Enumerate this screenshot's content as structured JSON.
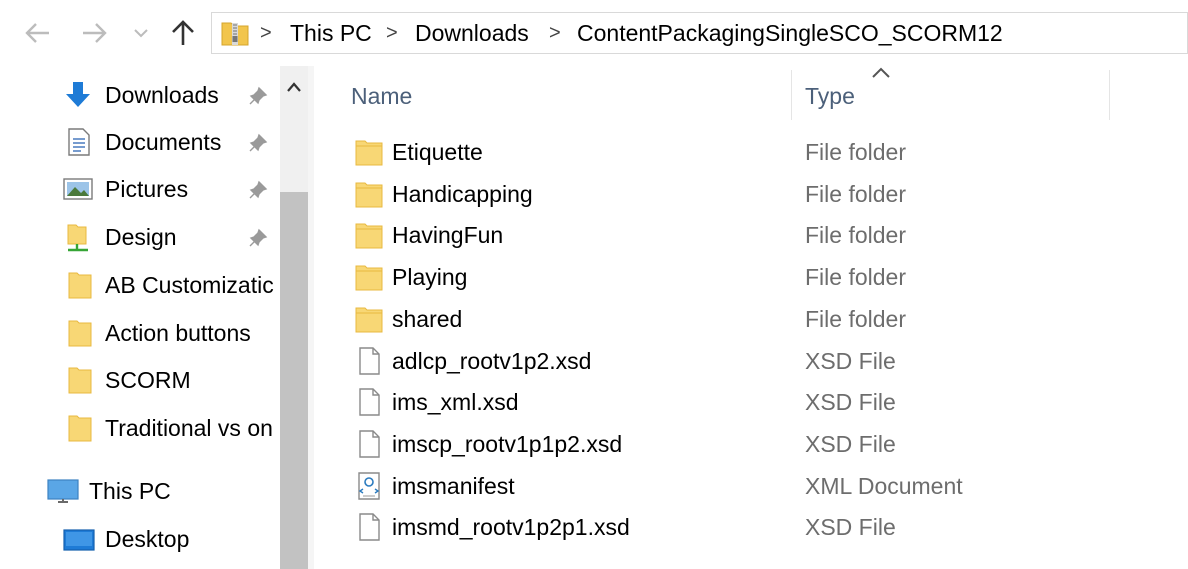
{
  "address": {
    "crumbs": [
      "This PC",
      "Downloads",
      "ContentPackagingSingleSCO_SCORM12"
    ],
    "separator": ">"
  },
  "navigation": {
    "buttons": [
      "back-arrow-icon",
      "forward-arrow-icon",
      "recent-locations-icon",
      "up-arrow-icon"
    ]
  },
  "sidebar": {
    "items": [
      {
        "label": "Downloads",
        "icon": "downloads-icon",
        "pinned": true
      },
      {
        "label": "Documents",
        "icon": "documents-icon",
        "pinned": true
      },
      {
        "label": "Pictures",
        "icon": "pictures-icon",
        "pinned": true
      },
      {
        "label": "Design",
        "icon": "network-folder-icon",
        "pinned": true
      },
      {
        "label": "AB Customizatic",
        "icon": "folder-icon",
        "pinned": false
      },
      {
        "label": "Action buttons",
        "icon": "folder-icon",
        "pinned": false
      },
      {
        "label": "SCORM",
        "icon": "folder-icon",
        "pinned": false
      },
      {
        "label": "Traditional vs on",
        "icon": "folder-icon",
        "pinned": false
      },
      {
        "label": "This PC",
        "icon": "this-pc-icon",
        "pinned": false
      },
      {
        "label": "Desktop",
        "icon": "desktop-icon",
        "pinned": false
      }
    ]
  },
  "filelist": {
    "columns": {
      "name": "Name",
      "type": "Type"
    },
    "sort": "name-ascending",
    "rows": [
      {
        "name": "Etiquette",
        "type": "File folder",
        "icon": "folder-icon"
      },
      {
        "name": "Handicapping",
        "type": "File folder",
        "icon": "folder-icon"
      },
      {
        "name": "HavingFun",
        "type": "File folder",
        "icon": "folder-icon"
      },
      {
        "name": "Playing",
        "type": "File folder",
        "icon": "folder-icon"
      },
      {
        "name": "shared",
        "type": "File folder",
        "icon": "folder-icon"
      },
      {
        "name": "adlcp_rootv1p2.xsd",
        "type": "XSD File",
        "icon": "file-icon"
      },
      {
        "name": "ims_xml.xsd",
        "type": "XSD File",
        "icon": "file-icon"
      },
      {
        "name": "imscp_rootv1p1p2.xsd",
        "type": "XSD File",
        "icon": "file-icon"
      },
      {
        "name": "imsmanifest",
        "type": "XML Document",
        "icon": "xml-file-icon"
      },
      {
        "name": "imsmd_rootv1p2p1.xsd",
        "type": "XSD File",
        "icon": "file-icon"
      }
    ]
  },
  "colors": {
    "folder": "#f8d775",
    "folder_dark": "#e8b940",
    "header_text": "#4c607a",
    "type_text": "#6d6d6d",
    "accent_blue": "#1e7bd6"
  }
}
